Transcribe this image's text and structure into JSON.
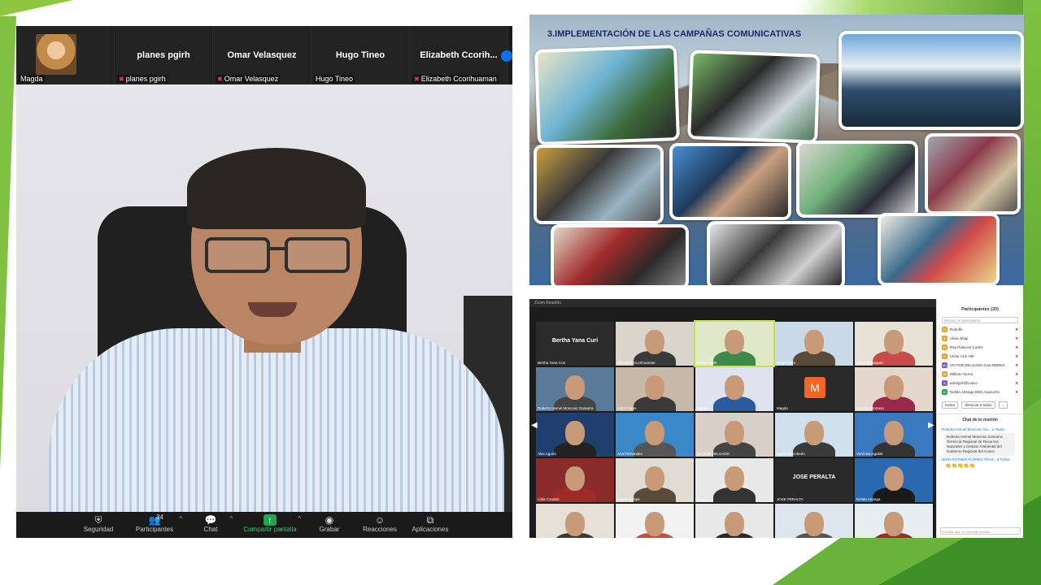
{
  "main_call": {
    "strip_tiles": [
      {
        "name": "",
        "label": "Magda",
        "muted": false,
        "has_photo": true
      },
      {
        "name": "planes pgirh",
        "label": "planes pgirh",
        "muted": true
      },
      {
        "name": "Omar Velasquez",
        "label": "Omar Velasquez",
        "muted": true
      },
      {
        "name": "Hugo Tineo",
        "label": "Hugo Tineo",
        "muted": false
      },
      {
        "name": "Elizabeth  Ccorih...",
        "label": "Elizabeth Ccorihuaman",
        "muted": true
      }
    ],
    "toolbar": {
      "security": "Seguridad",
      "participants": "Participantes",
      "participants_count": "34",
      "chat": "Chat",
      "share": "Compartir pantalla",
      "record": "Grabar",
      "reactions": "Reacciones",
      "apps": "Aplicaciones"
    }
  },
  "slide_photo": {
    "title": "3.IMPLEMENTACIÓN DE LAS CAMPAÑAS COMUNICATIVAS"
  },
  "gallery": {
    "window_title": "Zoom Reunión",
    "grid": [
      {
        "big": "Bertha Yana Curi",
        "name": "Bertha Yana Curi"
      },
      {
        "name": "Elizabeth Ccorihuaman"
      },
      {
        "name": "planes pgirh",
        "selected": true
      },
      {
        "name": "Hugo Tineo"
      },
      {
        "name": "Omar Velasquez"
      },
      {
        "name": "Roberto Hemel Moscoso Gamarra"
      },
      {
        "name": "Zoila Flores"
      },
      {
        "name": "Magda"
      },
      {
        "avatar": "M",
        "name": "Magda"
      },
      {
        "name": "Carolina Romero"
      },
      {
        "name": "Alex Agurto"
      },
      {
        "name": "Ana Fernandez"
      },
      {
        "name": "VICTOR DELGADO"
      },
      {
        "name": "Cecilia Escobedo"
      },
      {
        "name": "Verónica Aguilar"
      },
      {
        "name": "Lidia Condori"
      },
      {
        "name": "Edwin Quispe"
      },
      {
        "name": "Jose"
      },
      {
        "big": "JOSE PERALTA",
        "name": "JOSE PERALTA"
      },
      {
        "name": "Nelida Arteaga"
      },
      {
        "name": ""
      },
      {
        "name": ""
      },
      {
        "name": ""
      },
      {
        "name": ""
      },
      {
        "name": ""
      }
    ],
    "panel": {
      "title": "Participantes (33)",
      "search_placeholder": "Buscar un participante",
      "participants": [
        {
          "initials": "R",
          "name": "Rodolfo",
          "color": "#e6a23c"
        },
        {
          "initials": "A",
          "name": "Alicia Jibaji",
          "color": "#e6a23c"
        },
        {
          "initials": "R",
          "name": "Roy Palacios Cortez",
          "color": "#e6a23c"
        },
        {
          "initials": "V",
          "name": "Víctor ALS HM",
          "color": "#e6a23c"
        },
        {
          "initials": "VD",
          "name": "VICTOR DELGADO GALINDRES",
          "color": "#7b5cc4"
        },
        {
          "initials": "W",
          "name": "William Torres",
          "color": "#e6a23c"
        },
        {
          "initials": "A",
          "name": "adrelgirh@cusco",
          "color": "#7b5cc4"
        },
        {
          "initials": "N",
          "name": "Nelida Arteaga DDS Ayacucho",
          "color": "#2fa84f"
        }
      ],
      "buttons": [
        "Invitar",
        "Silenciar a todos",
        "..."
      ],
      "chat_title": "Chat de la reunión",
      "chat_sender": "Roberto Hemel Moscoso Ga... a Todos",
      "chat_text": "Roberto Hemel Moscoso Gamarra, Gerencia Regional de Recursos Naturales y Gestión Ambiental del Gobierno Regional del Cusco",
      "chat_sender2": "NIDIA ESTHER FLORES TRAV... a Todos",
      "chat_input": "Escriba aquí su mensaje a todos"
    }
  }
}
